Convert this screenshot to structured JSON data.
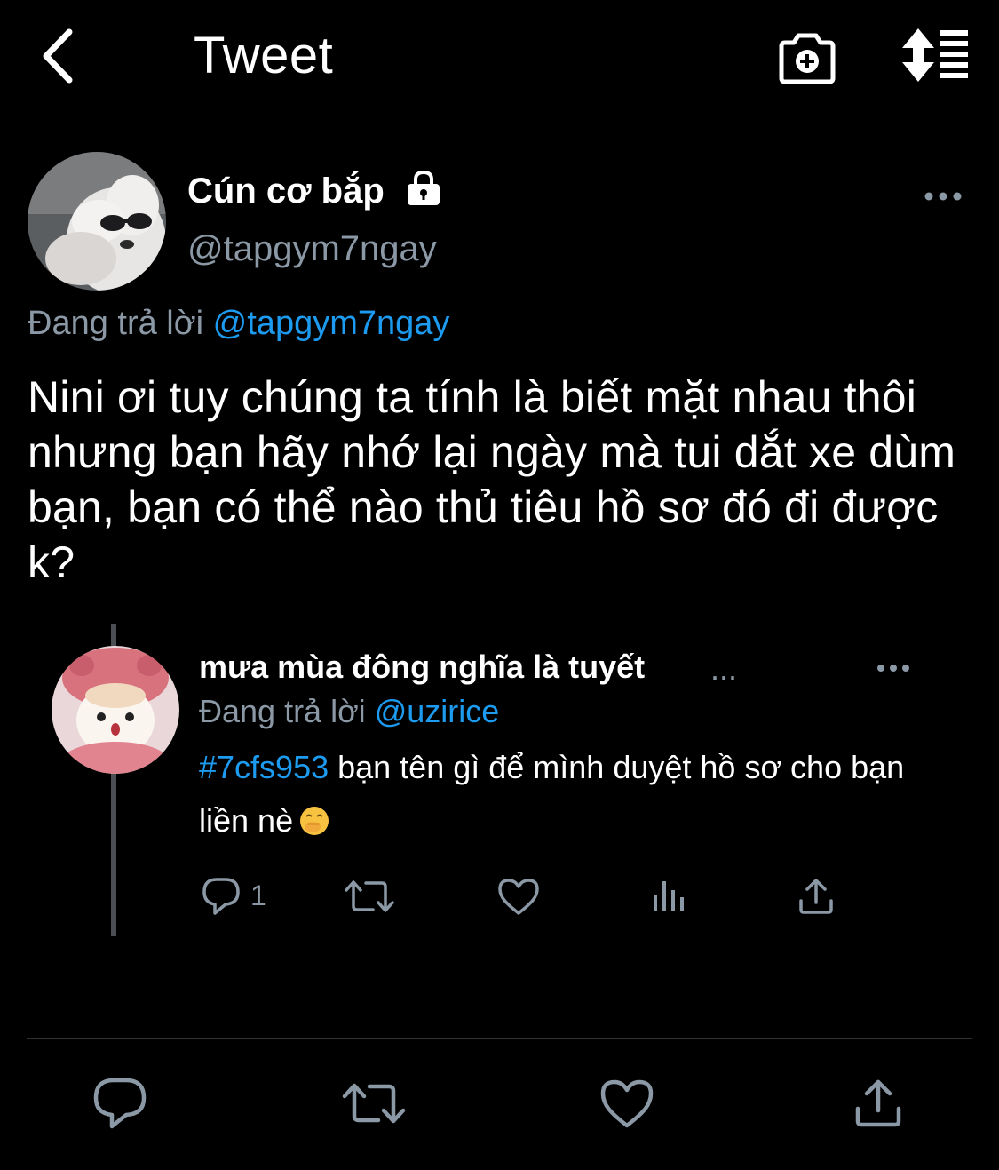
{
  "header": {
    "title": "Tweet",
    "back_icon": "chevron-left-icon",
    "camera_icon": "camera-plus-icon",
    "sort_icon": "sort-list-icon"
  },
  "tweet": {
    "author_name": "Cún cơ bắp",
    "author_handle": "@tapgym7ngay",
    "protected_icon": "lock-icon",
    "replying_prefix": "Đang trả lời",
    "replying_to": "@tapgym7ngay",
    "text": "Nini ơi tuy chúng ta tính là biết mặt nhau thôi nhưng bạn hãy nhớ lại ngày mà tui dắt xe dùm bạn, bạn có thể nào thủ tiêu hồ sơ đó đi được k?"
  },
  "quoted_reply": {
    "author_name": "mưa mùa đông nghĩa là tuyết",
    "name_ellipsis": "...",
    "replying_prefix": "Đang trả lời",
    "replying_to": "@uzirice",
    "hashtag": "#7cfs953",
    "text": " bạn tên gì để mình duyệt hồ sơ cho bạn liền nè",
    "emoji": "face-with-hand-over-mouth",
    "reply_count": "1"
  },
  "colors": {
    "background": "#000000",
    "text": "#ffffff",
    "muted": "#8b98a5",
    "link": "#1d9bf0",
    "divider": "#2f3336",
    "thread_line": "#4b4f54"
  }
}
